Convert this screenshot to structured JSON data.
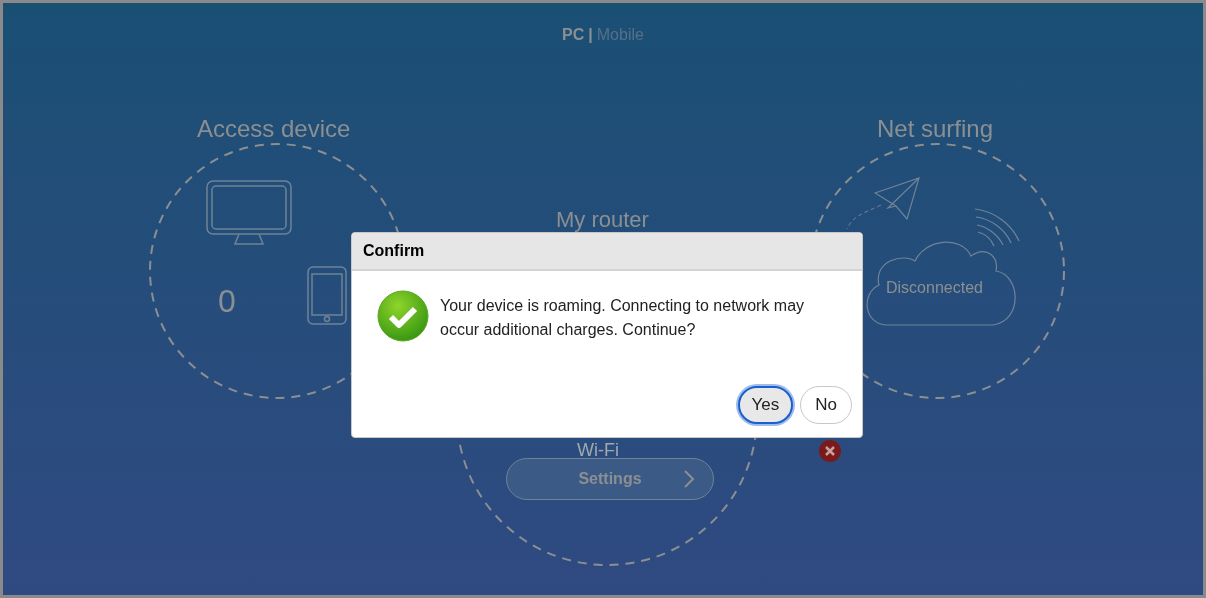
{
  "view_switch": {
    "options": [
      {
        "label": "PC",
        "selected": true
      },
      {
        "label": "Mobile",
        "selected": false
      }
    ],
    "separator": "|"
  },
  "access_device": {
    "title": "Access device",
    "count": "0"
  },
  "router": {
    "title": "My router",
    "wifi_label": "Wi-Fi",
    "settings_button": "Settings",
    "error": true
  },
  "net_surfing": {
    "title": "Net surfing",
    "status": "Disconnected"
  },
  "dialog": {
    "title": "Confirm",
    "message": "Your device is roaming. Connecting to network may occur additional charges. Continue?",
    "buttons": [
      {
        "label": "Yes",
        "selected": true
      },
      {
        "label": "No",
        "selected": false
      }
    ]
  }
}
